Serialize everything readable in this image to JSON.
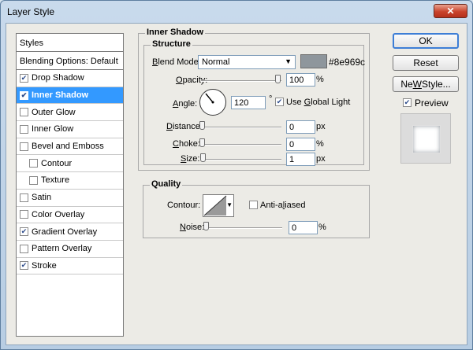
{
  "window": {
    "title": "Layer Style",
    "close_glyph": "✕"
  },
  "styles_panel": {
    "header": "Styles",
    "blending_options": "Blending Options: Default",
    "items": [
      {
        "label": "Drop Shadow",
        "checked": true
      },
      {
        "label": "Inner Shadow",
        "checked": true,
        "selected": true
      },
      {
        "label": "Outer Glow",
        "checked": false
      },
      {
        "label": "Inner Glow",
        "checked": false
      },
      {
        "label": "Bevel and Emboss",
        "checked": false
      },
      {
        "label": "Contour",
        "checked": false
      },
      {
        "label": "Texture",
        "checked": false
      },
      {
        "label": "Satin",
        "checked": false
      },
      {
        "label": "Color Overlay",
        "checked": false
      },
      {
        "label": "Gradient Overlay",
        "checked": true
      },
      {
        "label": "Pattern Overlay",
        "checked": false
      },
      {
        "label": "Stroke",
        "checked": true
      }
    ]
  },
  "inner_shadow": {
    "section_title": "Inner Shadow",
    "structure_title": "Structure",
    "blend_mode_label_u": "B",
    "blend_mode_label_rest": "lend Mode:",
    "blend_mode_value": "Normal",
    "color_hex": "#8e969c",
    "opacity_label_u": "O",
    "opacity_label_rest": "pacity:",
    "opacity_value": "100",
    "opacity_unit": "%",
    "angle_label_u": "A",
    "angle_label_rest": "ngle:",
    "angle_value": "120",
    "angle_unit": "°",
    "use_global_light_pre": "Use ",
    "use_global_light_u": "G",
    "use_global_light_post": "lobal Light",
    "use_global_light_checked": true,
    "distance_label_u": "D",
    "distance_label_rest": "istance:",
    "distance_value": "0",
    "distance_unit": "px",
    "choke_label_u": "C",
    "choke_label_rest": "hoke:",
    "choke_value": "0",
    "choke_unit": "%",
    "size_label_u": "S",
    "size_label_rest": "ize:",
    "size_value": "1",
    "size_unit": "px"
  },
  "quality": {
    "title": "Quality",
    "contour_label": "Contour:",
    "anti_aliased_pre": "Anti-a",
    "anti_aliased_u": "l",
    "anti_aliased_post": "iased",
    "anti_aliased_checked": false,
    "noise_label_u": "N",
    "noise_label_rest": "oise:",
    "noise_value": "0",
    "noise_unit": "%"
  },
  "buttons": {
    "ok": "OK",
    "reset": "Reset",
    "new_style_u": "W",
    "new_style_pre": "Ne",
    "new_style_post": " Style...",
    "preview_label": "Preview",
    "preview_checked": true
  }
}
